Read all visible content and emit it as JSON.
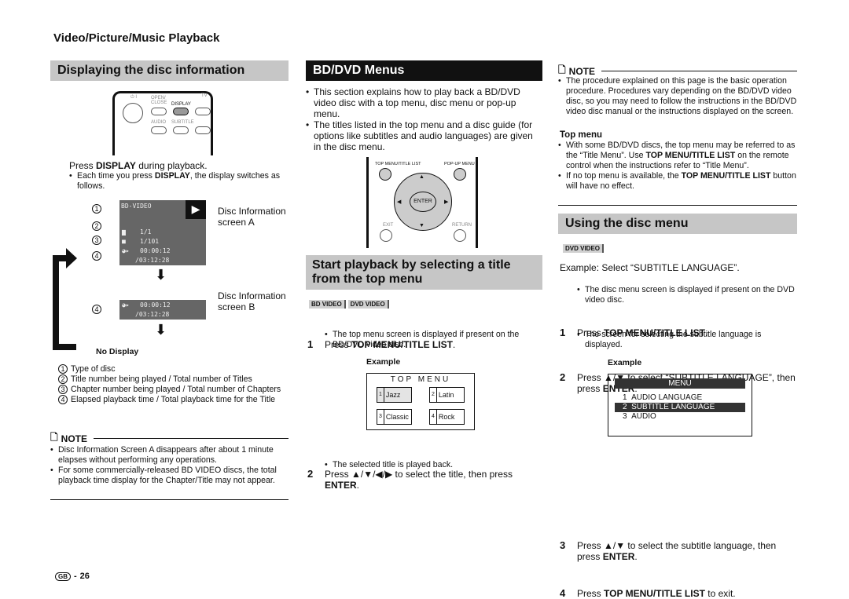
{
  "section_title": "Video/Picture/Music Playback",
  "left": {
    "header": "Displaying the disc information",
    "remote": {
      "power": "⏻ I",
      "open_close": "OPEN/ CLOSE",
      "display": "DISPLAY",
      "tv": "TV",
      "audio": "AUDIO",
      "subtitle": "SUBTITLE"
    },
    "press": {
      "pre": "Press ",
      "b": "DISPLAY",
      "post": " during playback."
    },
    "bullet": {
      "pre": "Each time you press ",
      "b": "DISPLAY",
      "post": ", the display switches as follows."
    },
    "screen_a": {
      "type": "BD-VIDEO",
      "title": "1/1",
      "chapter": "1/101",
      "elapsed": "00:00:12",
      "total": "/03:12:28",
      "label": "Disc Information screen A"
    },
    "screen_b": {
      "elapsed": "00:00:12",
      "total": "/03:12:28",
      "label": "Disc Information screen B"
    },
    "no_display": "No Display",
    "legend": [
      {
        "n": "1",
        "t": "Type of disc"
      },
      {
        "n": "2",
        "t": "Title number being played / Total number of Titles"
      },
      {
        "n": "3",
        "t": "Chapter number being played / Total number of Chapters"
      },
      {
        "n": "4",
        "t": "Elapsed playback time / Total playback time for the Title"
      }
    ],
    "note_label": "NOTE",
    "notes": [
      "Disc Information Screen A disappears after about 1 minute elapses without performing any operations.",
      "For some commercially-released BD VIDEO discs, the total playback time display for the Chapter/Title may not appear."
    ]
  },
  "middle": {
    "header": "BD/DVD Menus",
    "bullets": [
      "This section explains how to play back a BD/DVD video disc with a top menu, disc menu or pop-up menu.",
      "The titles listed in the top menu and a disc guide (for options like subtitles and audio languages) are given in the disc menu."
    ],
    "remote": {
      "top_menu": "TOP MENU/TITLE LIST",
      "popup": "POP-UP MENU",
      "enter": "ENTER",
      "exit": "EXIT",
      "return": "RETURN"
    },
    "subheader": "Start playback by selecting a title from the top menu",
    "badges": [
      "BD VIDEO",
      "DVD VIDEO"
    ],
    "step1": {
      "n": "1",
      "pre": "Press ",
      "b": "TOP MENU/TITLE LIST",
      "post": ".",
      "bullet": "The top menu screen is displayed if present on the BD/DVD video disc."
    },
    "example_label": "Example",
    "top_menu": {
      "title": "TOP MENU",
      "items": [
        {
          "n": "1",
          "t": "Jazz"
        },
        {
          "n": "2",
          "t": "Latin"
        },
        {
          "n": "3",
          "t": "Classic"
        },
        {
          "n": "4",
          "t": "Rock"
        }
      ]
    },
    "step2": {
      "n": "2",
      "pre": "Press ▲/▼/◀/▶ to select the title, then press ",
      "b": "ENTER",
      "post": ".",
      "bullet": "The selected title is played back."
    }
  },
  "right": {
    "note_label": "NOTE",
    "note": "The procedure explained on this page is the basic operation procedure. Procedures vary depending on the BD/DVD video disc, so you may need to follow the instructions in the BD/DVD video disc manual or the instructions displayed on the screen.",
    "top_menu_heading": "Top menu",
    "tm_b1": {
      "pre": "With some BD/DVD discs, the top menu may be referred to as the “Title Menu”. Use ",
      "b": "TOP MENU/TITLE LIST",
      "post": " on the remote control when the instructions refer to “Title Menu”."
    },
    "tm_b2": {
      "pre": "If no top menu is available, the ",
      "b": "TOP MENU/TITLE LIST",
      "post": " button will have no effect."
    },
    "header": "Using the disc menu",
    "badge": "DVD VIDEO",
    "example_intro": "Example: Select “SUBTITLE LANGUAGE”.",
    "step1": {
      "n": "1",
      "pre": "Press ",
      "b": "TOP MENU/TITLE LIST",
      "post": ".",
      "bullet": "The disc menu screen is displayed if present on the DVD video disc."
    },
    "step2": {
      "n": "2",
      "pre": "Press ▲/▼ to select “SUBTITLE LANGUAGE”, then press ",
      "b": "ENTER",
      "post": ".",
      "bullet": "The screen for selecting the subtitle language is displayed."
    },
    "example_label": "Example",
    "menu": {
      "title": "MENU",
      "items": [
        {
          "n": "1",
          "t": "AUDIO LANGUAGE"
        },
        {
          "n": "2",
          "t": "SUBTITLE LANGUAGE",
          "selected": true
        },
        {
          "n": "3",
          "t": "AUDIO"
        }
      ]
    },
    "step3": {
      "n": "3",
      "pre": "Press ▲/▼ to select the subtitle language, then press ",
      "b": "ENTER",
      "post": "."
    },
    "step4": {
      "n": "4",
      "pre": "Press ",
      "b": "TOP MENU/TITLE LIST",
      "post": " to exit."
    }
  },
  "footer": {
    "region": "GB",
    "page": "26"
  }
}
